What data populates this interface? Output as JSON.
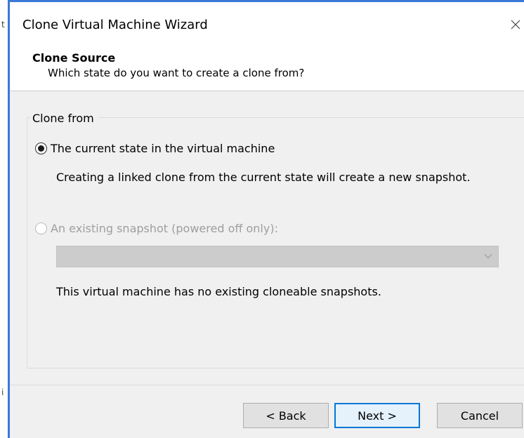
{
  "window": {
    "title": "Clone Virtual Machine Wizard",
    "close_glyph": "✕"
  },
  "background_fragments": [
    "t",
    "i"
  ],
  "header": {
    "title": "Clone Source",
    "subtitle": "Which state do you want to create a clone from?"
  },
  "clone_from": {
    "legend": "Clone from",
    "options": [
      {
        "label": "The current state in the virtual machine",
        "selected": true,
        "enabled": true,
        "description": "Creating a linked clone from the current state will create a new snapshot."
      },
      {
        "label": "An existing snapshot (powered off only):",
        "selected": false,
        "enabled": false,
        "snapshot_value": "",
        "description": "This virtual machine has no existing cloneable snapshots."
      }
    ]
  },
  "buttons": {
    "back": "< Back",
    "next": "Next >",
    "cancel": "Cancel"
  },
  "colors": {
    "accent": "#0078d7",
    "window_frame": "#3b78d8",
    "disabled_text": "#9e9e9e"
  },
  "icons": {
    "close": "close-icon",
    "dropdown": "chevron-down-icon"
  }
}
